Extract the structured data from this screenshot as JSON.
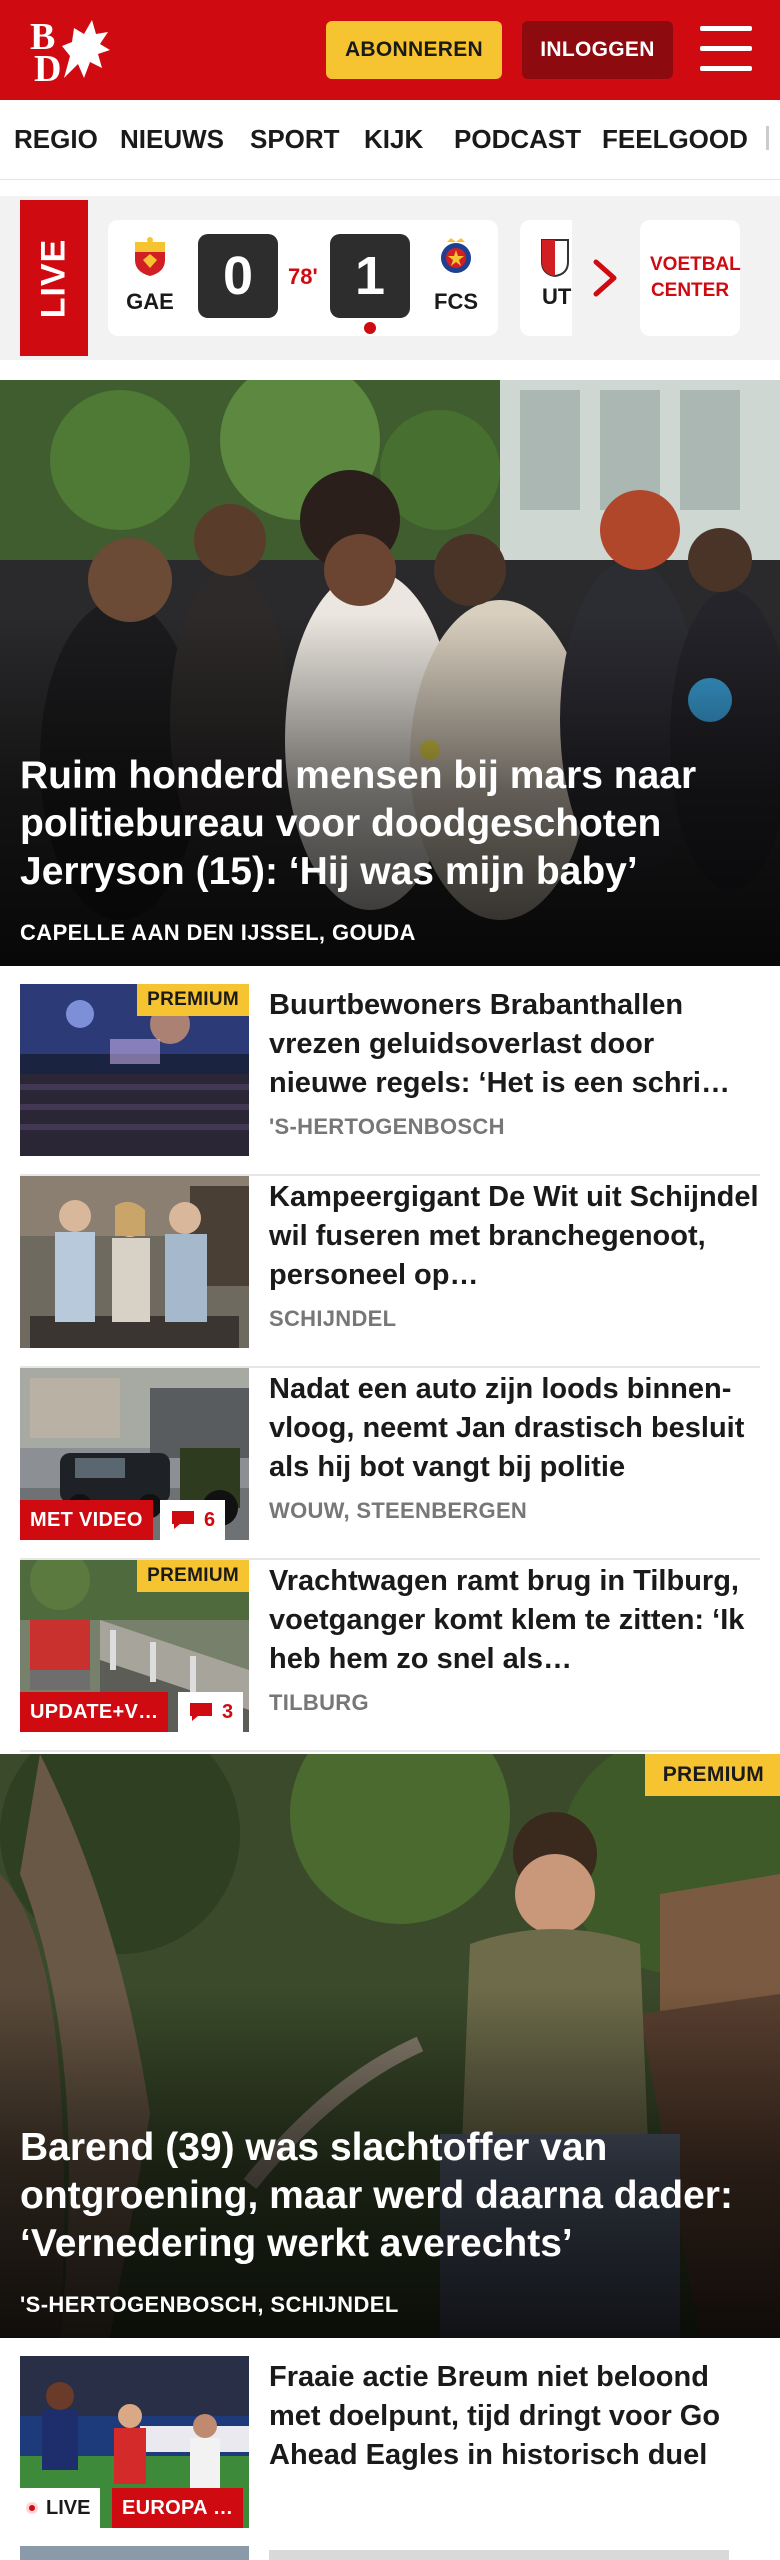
{
  "header": {
    "logo_letters": [
      "B",
      "D"
    ],
    "subscribe_label": "ABONNEREN",
    "login_label": "INLOGGEN",
    "menu_icon": "hamburger-icon",
    "brand_color": "#cf0a10",
    "accent_color": "#f6c331"
  },
  "nav": {
    "items": [
      "REGIO",
      "NIEUWS",
      "SPORT",
      "KIJK",
      "PODCAST",
      "FEELGOOD"
    ]
  },
  "live": {
    "badge": "LIVE",
    "match": {
      "home_team": "GAE",
      "home_score": "0",
      "minute": "78'",
      "away_score": "1",
      "away_team": "FCS"
    },
    "next_match_team": "UT",
    "next_icon": "chevron-right-icon",
    "voetbal_center": "VOETBAL CENTER"
  },
  "hero1": {
    "title": "Ruim honderd mensen bij mars naar politiebureau voor doodgeschoten Jerryson (15): ‘Hij was mijn baby’",
    "location": "CAPELLE AAN DEN IJSSEL, GOUDA"
  },
  "articles": [
    {
      "title": "Buurtbewoners Brabanthallen vrezen geluidsoverlast door nieuwe regels: ‘Het is een schri…",
      "location": "'S-HERTOGENBOSCH",
      "premium": "PREMIUM"
    },
    {
      "title": "Kampeergigant De Wit uit Schijndel wil fuseren met branchegenoot, personeel op…",
      "location": "SCHIJNDEL"
    },
    {
      "title": "Nadat een auto zijn loods binnen­vloog, neemt Jan drastisch besluit als hij bot vangt bij politie",
      "location": "WOUW, STEENBERGEN",
      "label": "MET VIDEO",
      "comments": "6"
    },
    {
      "title": "Vrachtwagen ramt brug in Tilburg, voetganger komt klem te zitten: ‘Ik heb hem zo snel als…",
      "location": "TILBURG",
      "premium": "PREMIUM",
      "label": "UPDATE+V…",
      "comments": "3"
    }
  ],
  "hero2": {
    "title": "Barend (39) was slachtoffer van ontgroening, maar werd daarna dader: ‘Vernedering werkt averechts’",
    "location": "'S-HERTOGENBOSCH, SCHIJNDEL",
    "premium": "PREMIUM"
  },
  "article_last": {
    "title": "Fraaie actie Breum niet beloond met doelpunt, tijd dringt voor Go Ahead Eagles in historisch duel",
    "live_label": "LIVE",
    "category": "EUROPA …"
  }
}
